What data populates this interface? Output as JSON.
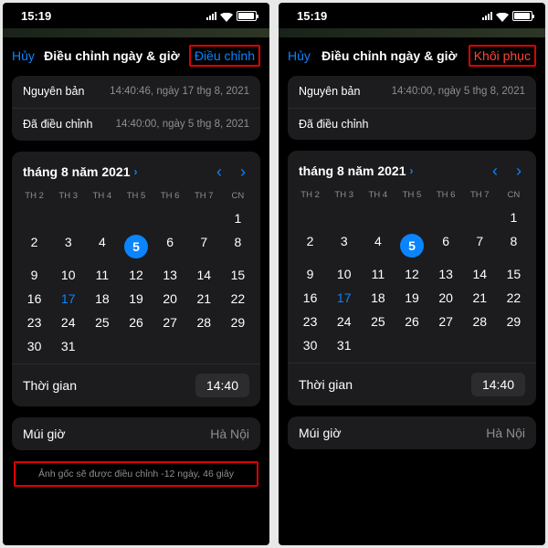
{
  "statusbar": {
    "time": "15:19"
  },
  "left": {
    "nav": {
      "cancel": "Hủy",
      "title": "Điều chỉnh ngày & giờ",
      "action": "Điều chỉnh"
    },
    "original": {
      "label": "Nguyên bản",
      "value": "14:40:46, ngày 17 thg 8, 2021"
    },
    "adjusted": {
      "label": "Đã điều chỉnh",
      "value": "14:40:00, ngày 5 thg 8, 2021"
    },
    "calendar": {
      "month": "tháng 8 năm 2021",
      "weekdays": [
        "TH 2",
        "TH 3",
        "TH 4",
        "TH 5",
        "TH 6",
        "TH 7",
        "CN"
      ],
      "selected_day": 5,
      "marked_day": 17
    },
    "time": {
      "label": "Thời gian",
      "value": "14:40"
    },
    "timezone": {
      "label": "Múi giờ",
      "value": "Hà Nội"
    },
    "footer": "Ảnh gốc sẽ được điều chỉnh -12 ngày, 46 giây"
  },
  "right": {
    "nav": {
      "cancel": "Hủy",
      "title": "Điều chỉnh ngày & giờ",
      "action": "Khôi phục"
    },
    "original": {
      "label": "Nguyên bản",
      "value": "14:40:00, ngày 5 thg 8, 2021"
    },
    "adjusted": {
      "label": "Đã điều chỉnh",
      "value": ""
    },
    "calendar": {
      "month": "tháng 8 năm 2021",
      "weekdays": [
        "TH 2",
        "TH 3",
        "TH 4",
        "TH 5",
        "TH 6",
        "TH 7",
        "CN"
      ],
      "selected_day": 5,
      "marked_day": 17
    },
    "time": {
      "label": "Thời gian",
      "value": "14:40"
    },
    "timezone": {
      "label": "Múi giờ",
      "value": "Hà Nội"
    }
  }
}
